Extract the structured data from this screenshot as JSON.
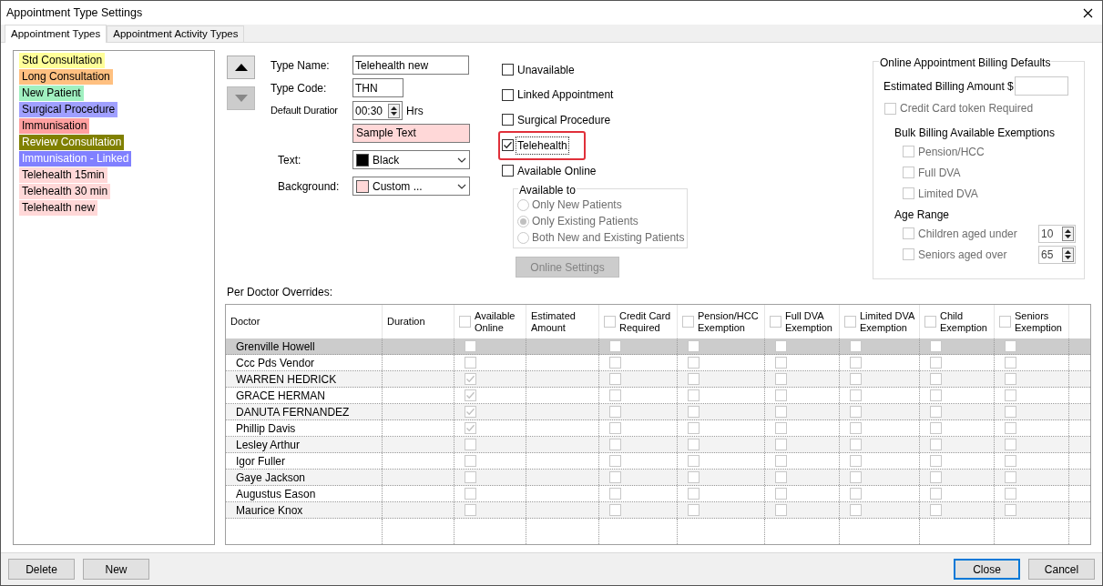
{
  "window": {
    "title": "Appointment Type Settings"
  },
  "tabs": [
    {
      "label": "Appointment Types",
      "selected": true
    },
    {
      "label": "Appointment Activity Types",
      "selected": false
    }
  ],
  "appointment_types": [
    {
      "label": "Std Consultation",
      "color": "#ffff99",
      "light_text": false
    },
    {
      "label": "Long Consultation",
      "color": "#ffc080",
      "light_text": false
    },
    {
      "label": "New Patient",
      "color": "#a0f0c0",
      "light_text": false
    },
    {
      "label": "Surgical Procedure",
      "color": "#a0a0ff",
      "light_text": false
    },
    {
      "label": "Immunisation",
      "color": "#ffa0a0",
      "light_text": false
    },
    {
      "label": "Review Consultation",
      "color": "#808000",
      "light_text": true
    },
    {
      "label": "Immunisation - Linked",
      "color": "#8080ff",
      "light_text": true
    },
    {
      "label": "Telehealth 15min",
      "color": "#ffd8d8",
      "light_text": false
    },
    {
      "label": "Telehealth 30 min",
      "color": "#ffd8d8",
      "light_text": false
    },
    {
      "label": "Telehealth new",
      "color": "#ffd8d8",
      "light_text": false
    }
  ],
  "move_buttons": [
    {
      "kind": "up",
      "disabled": false
    },
    {
      "kind": "down",
      "disabled": true
    }
  ],
  "form": {
    "type_name": {
      "label": "Type Name:",
      "value": "Telehealth new"
    },
    "type_code": {
      "label": "Type Code:",
      "value": "THN"
    },
    "default_duration": {
      "label": "Default Duratior",
      "value": "00:30",
      "unit": "Hrs"
    },
    "sample_text": {
      "value": "Sample Text",
      "color": "#ffd8d8"
    },
    "text_color": {
      "label": "Text:",
      "value": "Black",
      "color": "#000000"
    },
    "background": {
      "label": "Background:",
      "value": "Custom ...",
      "color": "#ffd8d8"
    }
  },
  "options": [
    {
      "label": "Unavailable",
      "checked": false,
      "highlighted": false
    },
    {
      "label": "Linked Appointment",
      "checked": false,
      "highlighted": false
    },
    {
      "label": "Surgical Procedure",
      "checked": false,
      "highlighted": false
    },
    {
      "label": "Telehealth",
      "checked": true,
      "highlighted": true
    },
    {
      "label": "Available Online",
      "checked": false,
      "highlighted": false
    }
  ],
  "available_to": {
    "title": "Available to",
    "disabled": true,
    "options": [
      {
        "label": "Only New Patients",
        "selected": false
      },
      {
        "label": "Only Existing Patients",
        "selected": true
      },
      {
        "label": "Both New and Existing Patients",
        "selected": false
      }
    ]
  },
  "online_settings_button": {
    "label": "Online Settings",
    "disabled": true
  },
  "billing": {
    "title": "Online Appointment Billing Defaults",
    "estimated_label": "Estimated Billing Amount $",
    "credit_card": {
      "label": "Credit Card token Required",
      "checked": false,
      "disabled": true
    },
    "exemptions_title": "Bulk Billing Available Exemptions",
    "exemptions": [
      {
        "label": "Pension/HCC",
        "checked": false
      },
      {
        "label": "Full DVA",
        "checked": false
      },
      {
        "label": "Limited DVA",
        "checked": false
      }
    ],
    "age_title": "Age Range",
    "ages": [
      {
        "label": "Children aged under",
        "checked": false,
        "value": "10"
      },
      {
        "label": "Seniors aged over",
        "checked": false,
        "value": "65"
      }
    ]
  },
  "overrides": {
    "label": "Per Doctor Overrides:",
    "columns": [
      {
        "label": "Doctor",
        "kind": "text"
      },
      {
        "label": "Duration",
        "kind": "text"
      },
      {
        "label": "Available Online",
        "kind": "check",
        "checked": false
      },
      {
        "label": "Estimated Amount",
        "kind": "text"
      },
      {
        "label": "Credit Card Required",
        "kind": "check",
        "checked": false
      },
      {
        "label": "Pension/HCC Exemption",
        "kind": "check",
        "checked": false
      },
      {
        "label": "Full DVA Exemption",
        "kind": "check",
        "checked": false
      },
      {
        "label": "Limited DVA Exemption",
        "kind": "check",
        "checked": false
      },
      {
        "label": "Child Exemption",
        "kind": "check",
        "checked": false
      },
      {
        "label": "Seniors Exemption",
        "kind": "check",
        "checked": false
      }
    ],
    "rows": [
      {
        "doctor": "Grenville Howell",
        "selected": true,
        "checks": [
          false,
          false,
          false,
          false,
          false,
          false,
          false
        ]
      },
      {
        "doctor": "Ccc Pds Vendor",
        "selected": false,
        "checks": [
          false,
          false,
          false,
          false,
          false,
          false,
          false
        ]
      },
      {
        "doctor": "WARREN HEDRICK",
        "selected": false,
        "checks": [
          true,
          false,
          false,
          false,
          false,
          false,
          false
        ]
      },
      {
        "doctor": "GRACE HERMAN",
        "selected": false,
        "checks": [
          true,
          false,
          false,
          false,
          false,
          false,
          false
        ]
      },
      {
        "doctor": "DANUTA FERNANDEZ",
        "selected": false,
        "checks": [
          true,
          false,
          false,
          false,
          false,
          false,
          false
        ]
      },
      {
        "doctor": "Phillip Davis",
        "selected": false,
        "checks": [
          true,
          false,
          false,
          false,
          false,
          false,
          false
        ]
      },
      {
        "doctor": "Lesley Arthur",
        "selected": false,
        "checks": [
          false,
          false,
          false,
          false,
          false,
          false,
          false
        ]
      },
      {
        "doctor": "Igor Fuller",
        "selected": false,
        "checks": [
          false,
          false,
          false,
          false,
          false,
          false,
          false
        ]
      },
      {
        "doctor": "Gaye Jackson",
        "selected": false,
        "checks": [
          false,
          false,
          false,
          false,
          false,
          false,
          false
        ]
      },
      {
        "doctor": "Augustus Eason",
        "selected": false,
        "checks": [
          false,
          false,
          false,
          false,
          false,
          false,
          false
        ]
      },
      {
        "doctor": "Maurice Knox",
        "selected": false,
        "checks": [
          false,
          false,
          false,
          false,
          false,
          false,
          false
        ]
      }
    ]
  },
  "footer_buttons": [
    {
      "label": "Delete",
      "default": false
    },
    {
      "label": "New",
      "default": false
    }
  ],
  "dialog_buttons": [
    {
      "label": "Close",
      "default": true
    },
    {
      "label": "Cancel",
      "default": false
    }
  ]
}
